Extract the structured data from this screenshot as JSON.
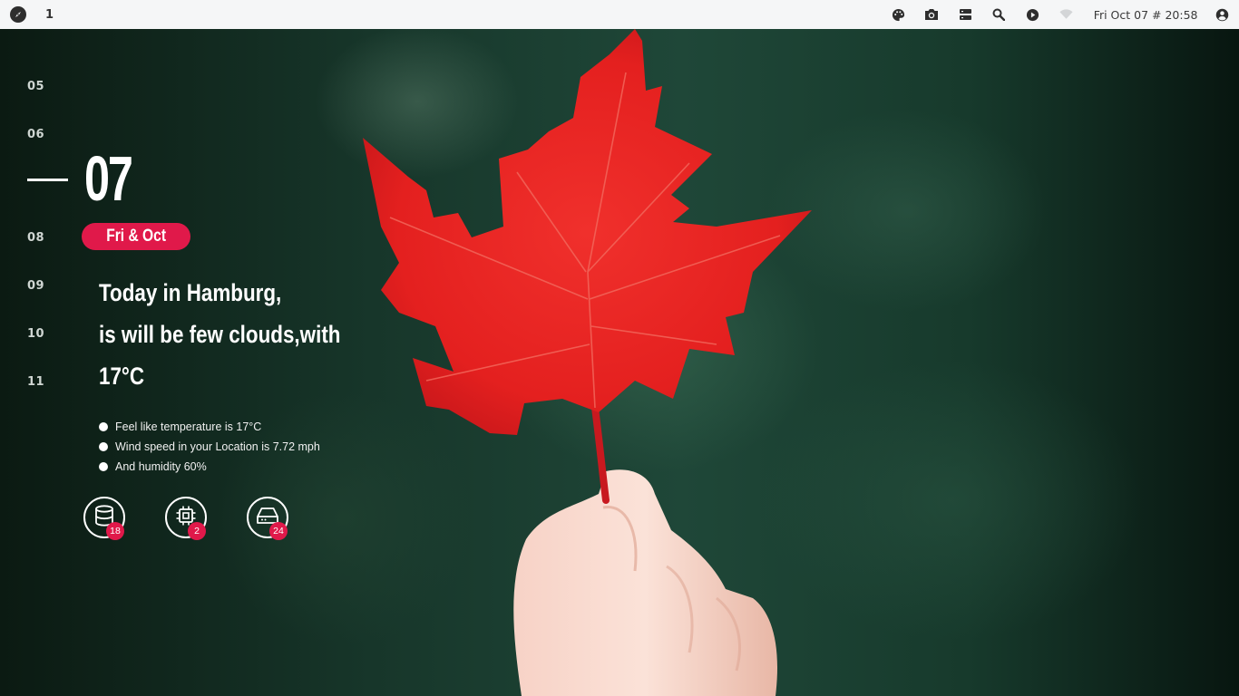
{
  "topbar": {
    "workspace": "1",
    "launcher_icon": "compass-icon",
    "tray_icons": [
      "palette-icon",
      "camera-icon",
      "server-icon",
      "search-icon",
      "play-icon",
      "wifi-icon"
    ],
    "clock": "Fri Oct 07 # 20:58",
    "user_icon": "account-icon"
  },
  "widget": {
    "timeline_days": [
      "05",
      "06",
      "08",
      "09",
      "10",
      "11"
    ],
    "current_day": "07",
    "day_month": "Fri & Oct",
    "weather_lines": [
      "Today in Hamburg,",
      "is will be few clouds,with",
      "17°C"
    ],
    "details": [
      "Feel like temperature is 17°C",
      "Wind speed in your Location is 7.72 mph",
      "And humidity 60%"
    ],
    "stats": [
      {
        "icon": "database-icon",
        "count": "18"
      },
      {
        "icon": "cpu-icon",
        "count": "2"
      },
      {
        "icon": "hard-drive-icon",
        "count": "24"
      }
    ]
  },
  "colors": {
    "accent": "#e0194a",
    "topbar_bg": "#f5f6f7",
    "leaf": "#e8252a"
  }
}
